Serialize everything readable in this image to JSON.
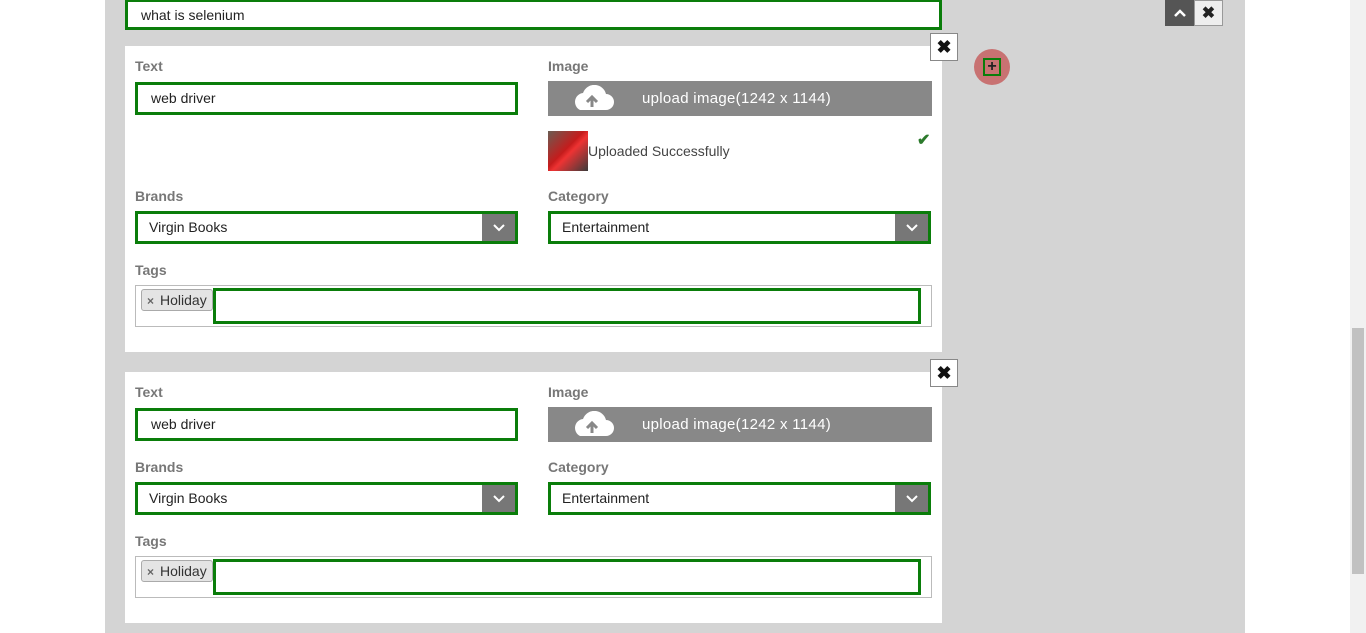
{
  "question": {
    "value": "what is selenium"
  },
  "controls": {
    "up_icon": "chevron-up-icon",
    "close_icon": "close-icon",
    "add_icon": "plus-icon"
  },
  "cards": [
    {
      "text_label": "Text",
      "text_value": "web driver",
      "image_label": "Image",
      "upload_label": "upload image(1242 x 1144)",
      "uploaded_text": "Uploaded Successfully",
      "brands_label": "Brands",
      "brand_value": "Virgin Books",
      "category_label": "Category",
      "category_value": "Entertainment",
      "tags_label": "Tags",
      "tag": "Holiday"
    },
    {
      "text_label": "Text",
      "text_value": "web driver",
      "image_label": "Image",
      "upload_label": "upload image(1242 x 1144)",
      "brands_label": "Brands",
      "brand_value": "Virgin Books",
      "category_label": "Category",
      "category_value": "Entertainment",
      "tags_label": "Tags",
      "tag": "Holiday"
    }
  ],
  "colors": {
    "accent_border": "#0a7d0a",
    "upload_bg": "#888888",
    "panel_bg": "#d4d4d4"
  }
}
